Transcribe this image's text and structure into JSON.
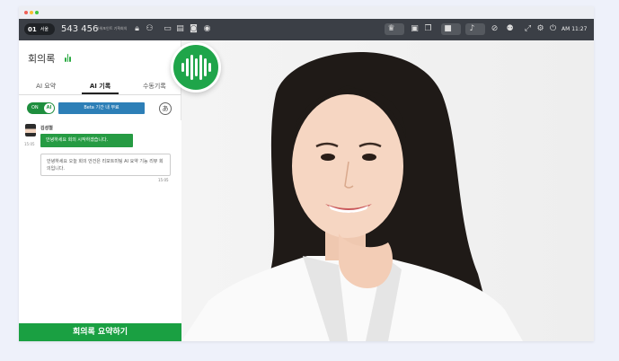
{
  "toolbar": {
    "room_number": "01",
    "room_location": "서울",
    "room_id": "543 456",
    "room_subtitle": "파워포인트 기획회의",
    "clock": "AM 11:27",
    "icons": [
      "lock-icon",
      "user-icon",
      "laptop-icon",
      "document-icon",
      "camera-icon",
      "record-icon",
      "crown-icon",
      "layout-icon",
      "copy-icon",
      "video-icon",
      "mic-icon",
      "speaker-icon",
      "participants-icon",
      "fullscreen-icon",
      "settings-icon",
      "exit-icon"
    ]
  },
  "panel": {
    "title": "회의록",
    "tabs": [
      {
        "label": "AI 요약"
      },
      {
        "label": "AI 기록"
      },
      {
        "label": "수동기록"
      }
    ],
    "toggle_on": "ON",
    "toggle_knob": "AI",
    "beta_notice": "Beta 기간 내 무료",
    "lang_button": "あ"
  },
  "chat": {
    "speaker": "김성철",
    "time1": "15:05",
    "message1": "안녕하세요 회의 시작하겠습니다.",
    "message2": "안녕하세요 오늘 회의 안건은 리모트미팅 AI 요약 기능 리뷰 회의입니다.",
    "time2": "15:05"
  },
  "summary_button": "회의록 요약하기",
  "colors": {
    "accent_green": "#1aa042",
    "toolbar_bg": "#3b3f46",
    "beta_blue": "#2d7fb7",
    "page_bg": "#eef1fa"
  }
}
